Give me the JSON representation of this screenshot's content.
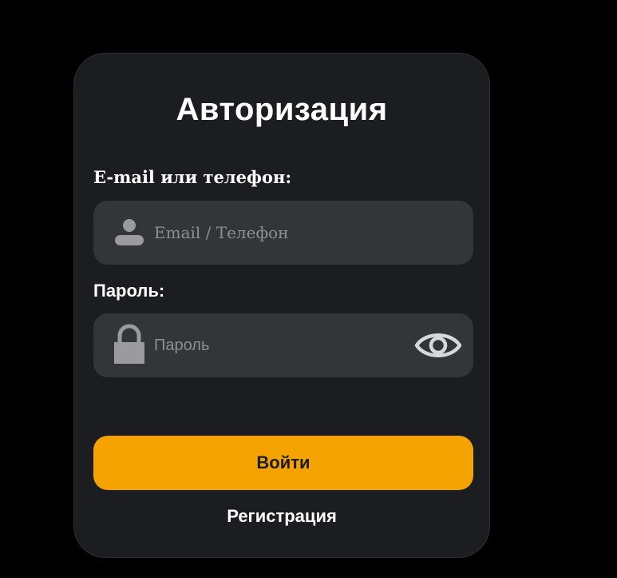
{
  "form": {
    "title": "Авторизация",
    "email_label": "E-mail или телефон:",
    "email_placeholder": "Email / Телефон",
    "email_value": "",
    "password_label": "Пароль:",
    "password_placeholder": "Пароль",
    "password_value": "",
    "login_label": "Войти",
    "register_label": "Регистрация"
  },
  "icons": {
    "email_field": "user-icon",
    "password_field": "lock-icon",
    "password_toggle": "eye-icon"
  },
  "colors": {
    "page_background": "#000000",
    "card_background": "#1c1d21",
    "field_background": "#343538",
    "accent": "#f5a300",
    "text": "#ffffff",
    "placeholder": "#8e8e93",
    "icon": "#9a9aa0"
  }
}
